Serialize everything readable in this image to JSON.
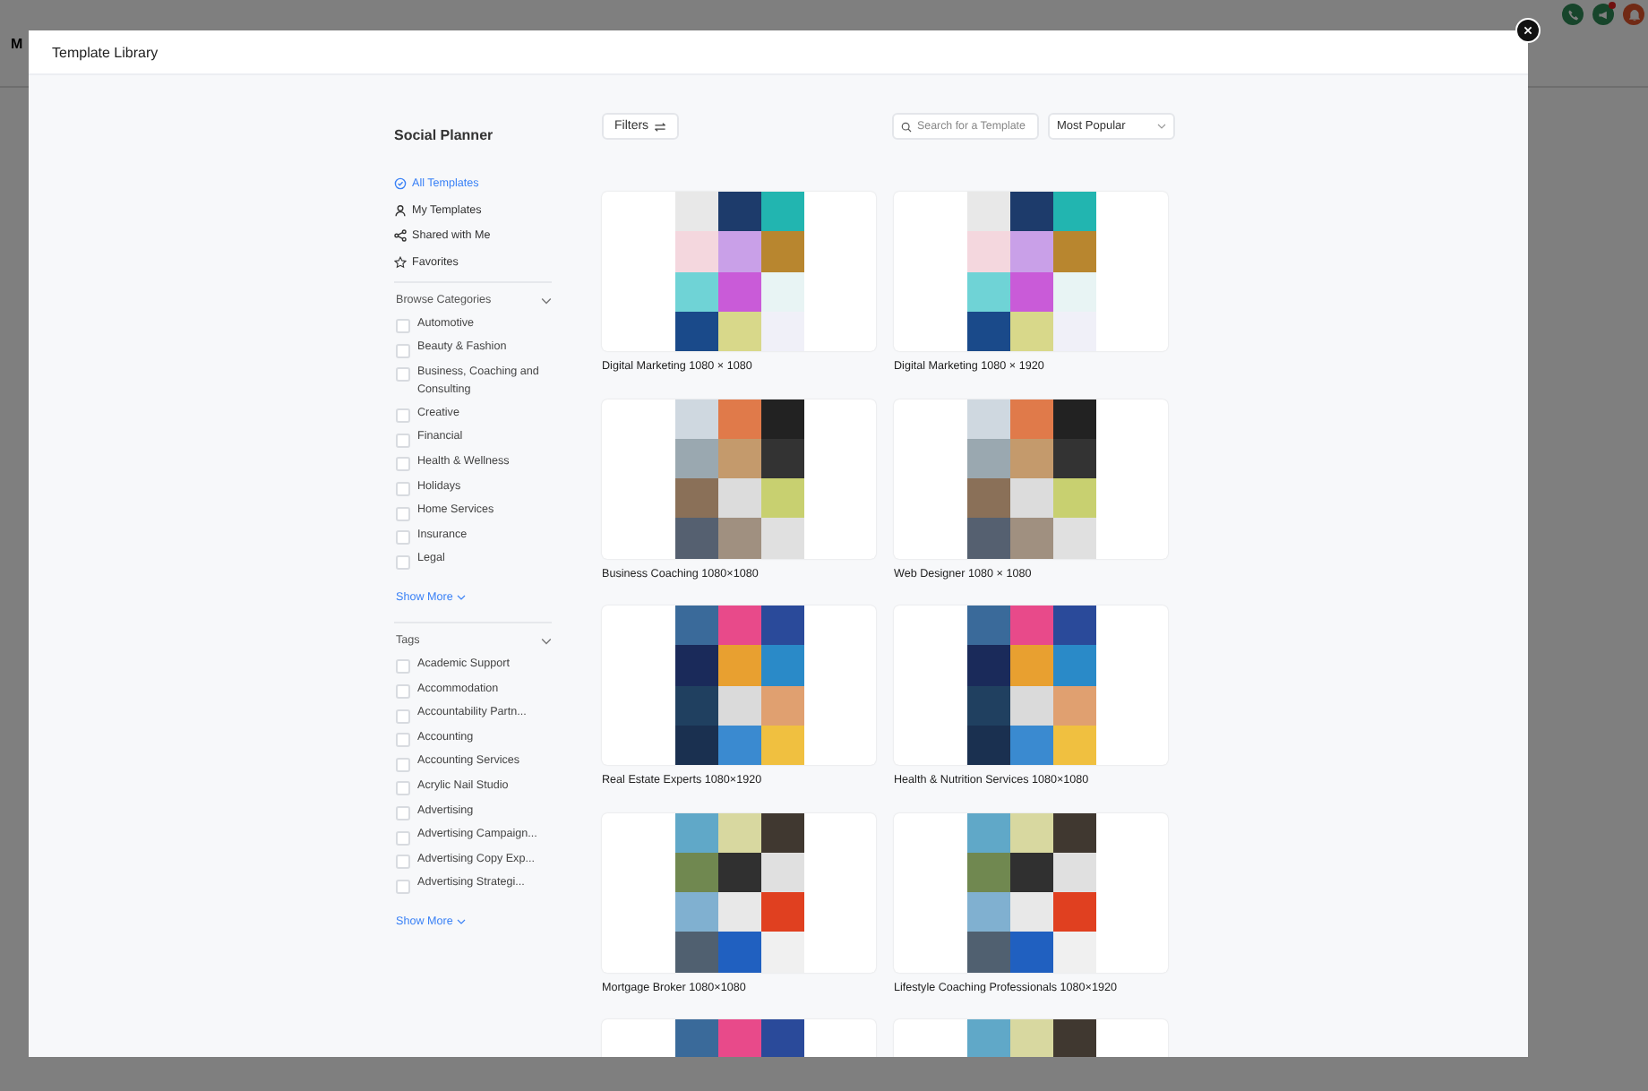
{
  "background": {
    "page_title": "M"
  },
  "modal": {
    "title": "Template Library"
  },
  "sidebar": {
    "title": "Social Planner",
    "nav": [
      {
        "label": "All Templates",
        "selected": true
      },
      {
        "label": "My Templates",
        "selected": false
      },
      {
        "label": "Shared with Me",
        "selected": false
      },
      {
        "label": "Favorites",
        "selected": false
      }
    ],
    "sections": [
      {
        "title": "Browse Categories",
        "expanded": true,
        "show_more": "Show More",
        "items": [
          {
            "label": "Automotive",
            "checked": false
          },
          {
            "label": "Beauty & Fashion",
            "checked": false
          },
          {
            "label": "Business, Coaching and Consulting",
            "checked": false
          },
          {
            "label": "Creative",
            "checked": false
          },
          {
            "label": "Financial",
            "checked": false
          },
          {
            "label": "Health & Wellness",
            "checked": false
          },
          {
            "label": "Holidays",
            "checked": false
          },
          {
            "label": "Home Services",
            "checked": false
          },
          {
            "label": "Insurance",
            "checked": false
          },
          {
            "label": "Legal",
            "checked": false
          }
        ]
      },
      {
        "title": "Tags",
        "expanded": true,
        "show_more": "Show More",
        "items": [
          {
            "label": "Academic Support",
            "checked": false
          },
          {
            "label": "Accommodation",
            "checked": false
          },
          {
            "label": "Accountability Partn...",
            "checked": false
          },
          {
            "label": "Accounting",
            "checked": false
          },
          {
            "label": "Accounting Services",
            "checked": false
          },
          {
            "label": "Acrylic Nail Studio",
            "checked": false
          },
          {
            "label": "Advertising",
            "checked": false
          },
          {
            "label": "Advertising Campaign...",
            "checked": false
          },
          {
            "label": "Advertising Copy Exp...",
            "checked": false
          },
          {
            "label": "Advertising Strategi...",
            "checked": false
          }
        ]
      }
    ]
  },
  "toolbar": {
    "filters": "Filters",
    "search": {
      "placeholder": "Search for a Template"
    },
    "sort": "Most Popular"
  },
  "templates": [
    {
      "title": "Digital Marketing 1080 × 1080"
    },
    {
      "title": "Digital Marketing 1080 × 1920"
    },
    {
      "title": "Business Coaching 1080×1080"
    },
    {
      "title": "Web Designer 1080 × 1080"
    },
    {
      "title": "Real Estate Experts 1080×1920"
    },
    {
      "title": "Health & Nutrition Services 1080×1080"
    },
    {
      "title": "Mortgage Broker 1080×1080"
    },
    {
      "title": "Lifestyle Coaching Professionals 1080×1920"
    }
  ]
}
